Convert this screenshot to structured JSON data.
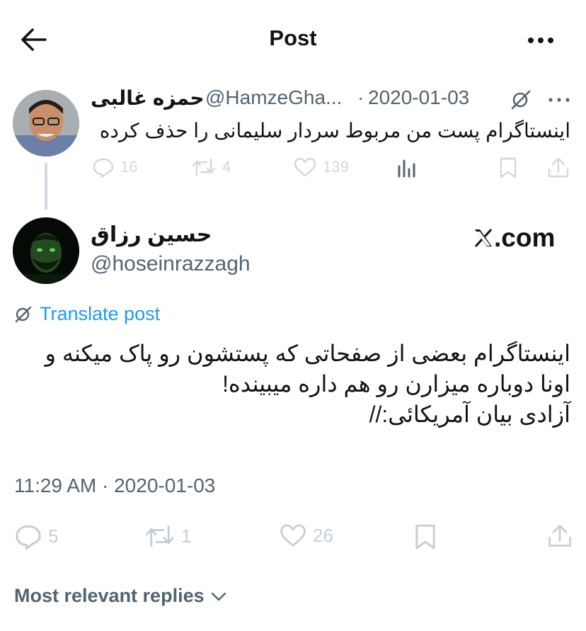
{
  "header": {
    "title": "Post",
    "back_icon": "arrow-left-icon",
    "more_icon": "more-horizontal-icon"
  },
  "parent_post": {
    "author_name": "حمزه غالبی",
    "handle": "@HamzeGha...",
    "separator": "·",
    "date": "2020-01-03",
    "text": "اینستاگرام پست من مربوط سردار سلیمانی را حذف کرده",
    "replies": "16",
    "reposts": "4",
    "likes": "139"
  },
  "main_post": {
    "author_name": "حسین رزاق",
    "handle": "@hoseinrazzagh",
    "watermark": ".com",
    "translate_label": "Translate post",
    "text": "اینستاگرام بعضی از صفحاتی که پستشون رو پاک میکنه و\nاونا دوباره میزارن رو هم داره میبینده!\nآزادی بیان آمریکائی://",
    "timestamp": "11:29 AM · 2020-01-03",
    "replies": "5",
    "reposts": "1",
    "likes": "26"
  },
  "replies_section": {
    "sort_label": "Most relevant replies"
  },
  "colors": {
    "text": "#0f1419",
    "secondary": "#536471",
    "accent": "#1d9bf0",
    "muted_icon": "#cfd9de"
  }
}
